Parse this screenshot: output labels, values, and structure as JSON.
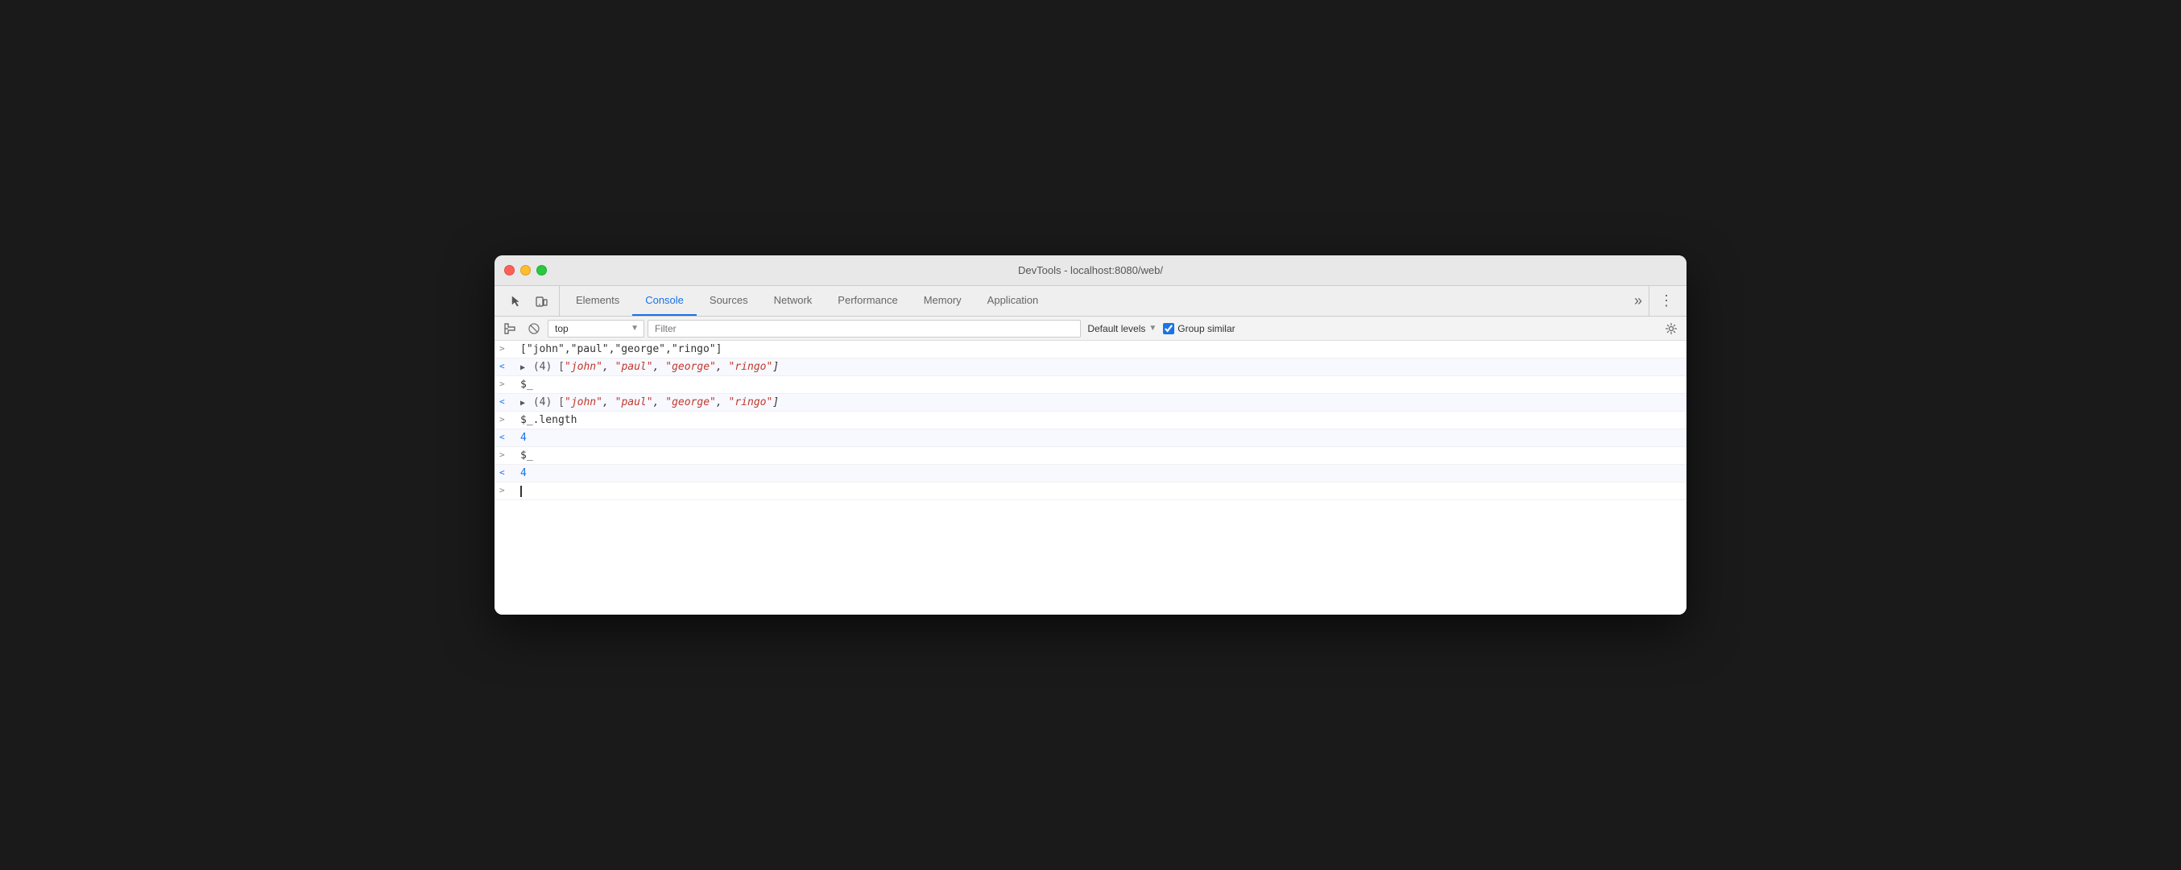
{
  "window": {
    "title": "DevTools - localhost:8080/web/"
  },
  "tabs": {
    "items": [
      {
        "id": "elements",
        "label": "Elements",
        "active": false
      },
      {
        "id": "console",
        "label": "Console",
        "active": true
      },
      {
        "id": "sources",
        "label": "Sources",
        "active": false
      },
      {
        "id": "network",
        "label": "Network",
        "active": false
      },
      {
        "id": "performance",
        "label": "Performance",
        "active": false
      },
      {
        "id": "memory",
        "label": "Memory",
        "active": false
      },
      {
        "id": "application",
        "label": "Application",
        "active": false
      }
    ],
    "more_label": "»",
    "settings_label": "⋮"
  },
  "toolbar": {
    "context": "top",
    "filter_placeholder": "Filter",
    "default_levels_label": "Default levels",
    "group_similar_label": "Group similar"
  },
  "console": {
    "rows": [
      {
        "type": "input",
        "arrow": ">",
        "content_text": "[\"john\",\"paul\",\"george\",\"ringo\"]"
      },
      {
        "type": "output_expandable",
        "arrow": "<",
        "expand": true,
        "count": "4",
        "items": [
          "\"john\"",
          "\"paul\"",
          "\"george\"",
          "\"ringo\""
        ]
      },
      {
        "type": "input",
        "arrow": ">",
        "content_text": "$_"
      },
      {
        "type": "output_expandable",
        "arrow": "<",
        "expand": true,
        "count": "4",
        "items": [
          "\"john\"",
          "\"paul\"",
          "\"george\"",
          "\"ringo\""
        ]
      },
      {
        "type": "input",
        "arrow": ">",
        "content_text": "$_.length"
      },
      {
        "type": "output_number",
        "arrow": "<",
        "value": "4"
      },
      {
        "type": "input",
        "arrow": ">",
        "content_text": "$_"
      },
      {
        "type": "output_number",
        "arrow": "<",
        "value": "4"
      },
      {
        "type": "prompt",
        "arrow": ">"
      }
    ]
  }
}
